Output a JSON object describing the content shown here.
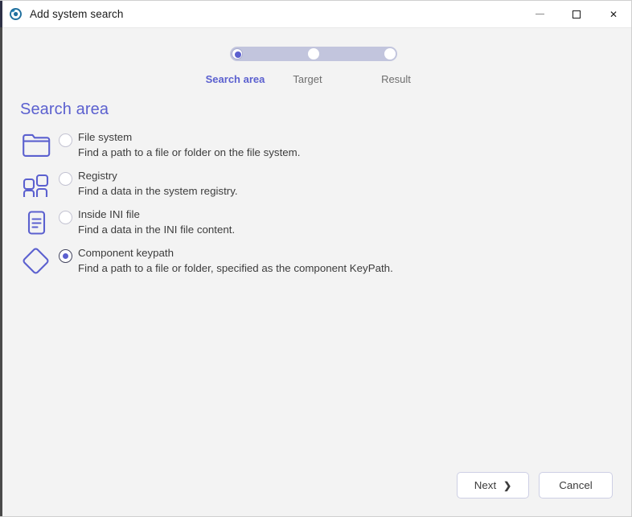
{
  "window": {
    "title": "Add system search",
    "app_icon": "app-logo-icon",
    "controls": {
      "minimize": "minimize-icon",
      "maximize": "maximize-icon",
      "close": "close-icon",
      "close_glyph": "✕"
    }
  },
  "stepper": {
    "steps": [
      {
        "label": "Search area",
        "state": "active"
      },
      {
        "label": "Target",
        "state": "pending"
      },
      {
        "label": "Result",
        "state": "pending"
      }
    ],
    "track_color": "#c2c5dd",
    "active_color": "#5b60cf"
  },
  "main": {
    "heading": "Search area",
    "heading_color": "#5b60cf",
    "options": [
      {
        "icon": "folder-icon",
        "title": "File system",
        "description": "Find a path to a file or folder on the file system.",
        "selected": false
      },
      {
        "icon": "registry-grid-icon",
        "title": "Registry",
        "description": "Find a data in the system registry.",
        "selected": false
      },
      {
        "icon": "ini-file-icon",
        "title": "Inside INI file",
        "description": "Find a data in the INI file content.",
        "selected": false
      },
      {
        "icon": "diamond-keypath-icon",
        "title": "Component keypath",
        "description": "Find a path to a file or folder, specified as the component KeyPath.",
        "selected": true
      }
    ]
  },
  "footer": {
    "next_label": "Next",
    "next_chevron": "❯",
    "cancel_label": "Cancel"
  }
}
